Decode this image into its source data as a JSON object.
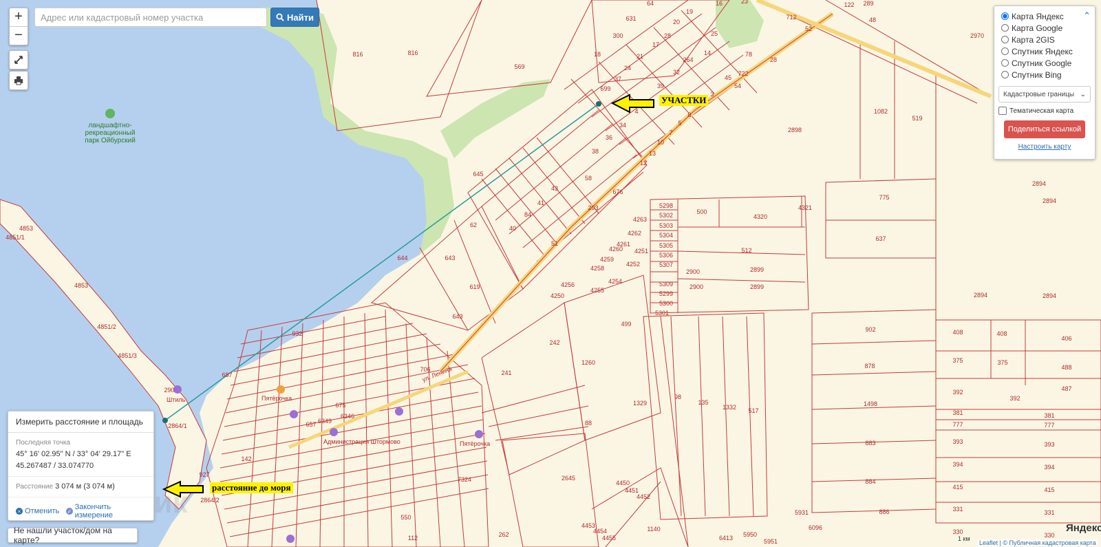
{
  "search": {
    "placeholder": "Адрес или кадастровый номер участка",
    "button_label": "Найти"
  },
  "zoom": {
    "in": "+",
    "out": "−"
  },
  "layers": {
    "options": [
      "Карта Яндекс",
      "Карта Google",
      "Карта 2GIS",
      "Спутник Яндекс",
      "Спутник Google",
      "Спутник Bing"
    ],
    "selected_index": 0,
    "overlay_select": "Кадастровые границы",
    "thematic_label": "Тематическая карта",
    "share_label": "Поделиться ссылкой",
    "setup_link": "Настроить карту"
  },
  "measure": {
    "title": "Измерить расстояние и площадь",
    "last_point_label": "Последняя точка",
    "coords_dms": "45° 16' 02.95\" N / 33° 04' 29.17\" E",
    "coords_dec": "45.267487 / 33.074770",
    "distance_label": "Расстояние",
    "distance_value": "3 074 м (3 074 м)",
    "cancel_label": "Отменить",
    "finish_label": "Закончить измерение"
  },
  "not_found": "Не нашли участок/дом на карте?",
  "annotations": {
    "plots": "УЧАСТКИ",
    "sea_distance": "расстояние до моря"
  },
  "park_label": [
    "ландшафтно-",
    "рекреационный",
    "парк Ойбурский"
  ],
  "street_label": "ул. Ленина",
  "place_labels": [
    "Штиль",
    "Пятёрочка",
    "Администрация Штормово",
    "Пятёрочка"
  ],
  "attribution": {
    "yandex": "Яндекс",
    "leaflet": "Leaflet | © Публичная кадастровая карта",
    "scale": "1 км"
  },
  "watermark": "ДомКлик",
  "parcel_labels": [
    {
      "t": "816"
    },
    {
      "t": "816"
    },
    {
      "t": "569"
    },
    {
      "t": "631"
    },
    {
      "t": "300"
    },
    {
      "t": "18"
    },
    {
      "t": "21"
    },
    {
      "t": "24"
    },
    {
      "t": "17"
    },
    {
      "t": "28"
    },
    {
      "t": "20"
    },
    {
      "t": "19"
    },
    {
      "t": "64"
    },
    {
      "t": "16"
    },
    {
      "t": "23"
    },
    {
      "t": "25"
    },
    {
      "t": "264"
    },
    {
      "t": "14"
    },
    {
      "t": "32"
    },
    {
      "t": "78"
    },
    {
      "t": "45"
    },
    {
      "t": "722"
    },
    {
      "t": "54"
    },
    {
      "t": "28"
    },
    {
      "t": "712"
    },
    {
      "t": "52"
    },
    {
      "t": "289"
    },
    {
      "t": "48"
    },
    {
      "t": "122"
    },
    {
      "t": "2970"
    },
    {
      "t": "37"
    },
    {
      "t": "699"
    },
    {
      "t": "39"
    },
    {
      "t": "4"
    },
    {
      "t": "3"
    },
    {
      "t": "8"
    },
    {
      "t": "5"
    },
    {
      "t": "7"
    },
    {
      "t": "34"
    },
    {
      "t": "36"
    },
    {
      "t": "10"
    },
    {
      "t": "13"
    },
    {
      "t": "12"
    },
    {
      "t": "38"
    },
    {
      "t": "58"
    },
    {
      "t": "676"
    },
    {
      "t": "43"
    },
    {
      "t": "41"
    },
    {
      "t": "84"
    },
    {
      "t": "40"
    },
    {
      "t": "62"
    },
    {
      "t": "645"
    },
    {
      "t": "51"
    },
    {
      "t": "293"
    },
    {
      "t": "1082"
    },
    {
      "t": "519"
    },
    {
      "t": "2898"
    },
    {
      "t": "2894"
    },
    {
      "t": "2894"
    },
    {
      "t": "775"
    },
    {
      "t": "637"
    },
    {
      "t": "2894"
    },
    {
      "t": "2894"
    },
    {
      "t": "5298"
    },
    {
      "t": "5302"
    },
    {
      "t": "5303"
    },
    {
      "t": "5304"
    },
    {
      "t": "5305"
    },
    {
      "t": "5306"
    },
    {
      "t": "5307"
    },
    {
      "t": "5309"
    },
    {
      "t": "5299"
    },
    {
      "t": "5300"
    },
    {
      "t": "5301"
    },
    {
      "t": "500"
    },
    {
      "t": "4320"
    },
    {
      "t": "4321"
    },
    {
      "t": "512"
    },
    {
      "t": "2900"
    },
    {
      "t": "2899"
    },
    {
      "t": "2900"
    },
    {
      "t": "2899"
    },
    {
      "t": "4263"
    },
    {
      "t": "4262"
    },
    {
      "t": "4261"
    },
    {
      "t": "4251"
    },
    {
      "t": "4260"
    },
    {
      "t": "4259"
    },
    {
      "t": "4252"
    },
    {
      "t": "4258"
    },
    {
      "t": "4254"
    },
    {
      "t": "4256"
    },
    {
      "t": "4255"
    },
    {
      "t": "4250"
    },
    {
      "t": "644"
    },
    {
      "t": "643"
    },
    {
      "t": "619"
    },
    {
      "t": "643"
    },
    {
      "t": "499"
    },
    {
      "t": "242"
    },
    {
      "t": "241"
    },
    {
      "t": "1260"
    },
    {
      "t": "902"
    },
    {
      "t": "878"
    },
    {
      "t": "1498"
    },
    {
      "t": "883"
    },
    {
      "t": "884"
    },
    {
      "t": "886"
    },
    {
      "t": "408"
    },
    {
      "t": "408"
    },
    {
      "t": "406"
    },
    {
      "t": "375"
    },
    {
      "t": "375"
    },
    {
      "t": "488"
    },
    {
      "t": "487"
    },
    {
      "t": "392"
    },
    {
      "t": "392"
    },
    {
      "t": "381"
    },
    {
      "t": "381"
    },
    {
      "t": "777"
    },
    {
      "t": "777"
    },
    {
      "t": "393"
    },
    {
      "t": "393"
    },
    {
      "t": "394"
    },
    {
      "t": "394"
    },
    {
      "t": "415"
    },
    {
      "t": "415"
    },
    {
      "t": "331"
    },
    {
      "t": "331"
    },
    {
      "t": "330"
    },
    {
      "t": "330"
    },
    {
      "t": "1329"
    },
    {
      "t": "98"
    },
    {
      "t": "135"
    },
    {
      "t": "1332"
    },
    {
      "t": "517"
    },
    {
      "t": "88"
    },
    {
      "t": "2645"
    },
    {
      "t": "4450"
    },
    {
      "t": "4451"
    },
    {
      "t": "4452"
    },
    {
      "t": "4453"
    },
    {
      "t": "4454"
    },
    {
      "t": "4455"
    },
    {
      "t": "1140"
    },
    {
      "t": "5931"
    },
    {
      "t": "6096"
    },
    {
      "t": "5951"
    },
    {
      "t": "5950"
    },
    {
      "t": "6413"
    },
    {
      "t": "932"
    },
    {
      "t": "706"
    },
    {
      "t": "7324"
    },
    {
      "t": "142"
    },
    {
      "t": "927"
    },
    {
      "t": "550"
    },
    {
      "t": "112"
    },
    {
      "t": "262"
    },
    {
      "t": "675"
    },
    {
      "t": "6349"
    },
    {
      "t": "6346"
    },
    {
      "t": "657"
    },
    {
      "t": "4853"
    },
    {
      "t": "4851/1"
    },
    {
      "t": "4853"
    },
    {
      "t": "4851/2"
    },
    {
      "t": "4851/3"
    },
    {
      "t": "290"
    },
    {
      "t": "2864/1"
    },
    {
      "t": "2864/2"
    },
    {
      "t": "687"
    }
  ],
  "colors": {
    "water": "#b5d0ee",
    "land": "#fbf6e4",
    "park": "#cde5b0",
    "parcel_line": "#c8383a",
    "road": "#f6d67a",
    "measure_line": "#2a9a9a",
    "accent": "#337ab7",
    "danger": "#d9534f"
  }
}
